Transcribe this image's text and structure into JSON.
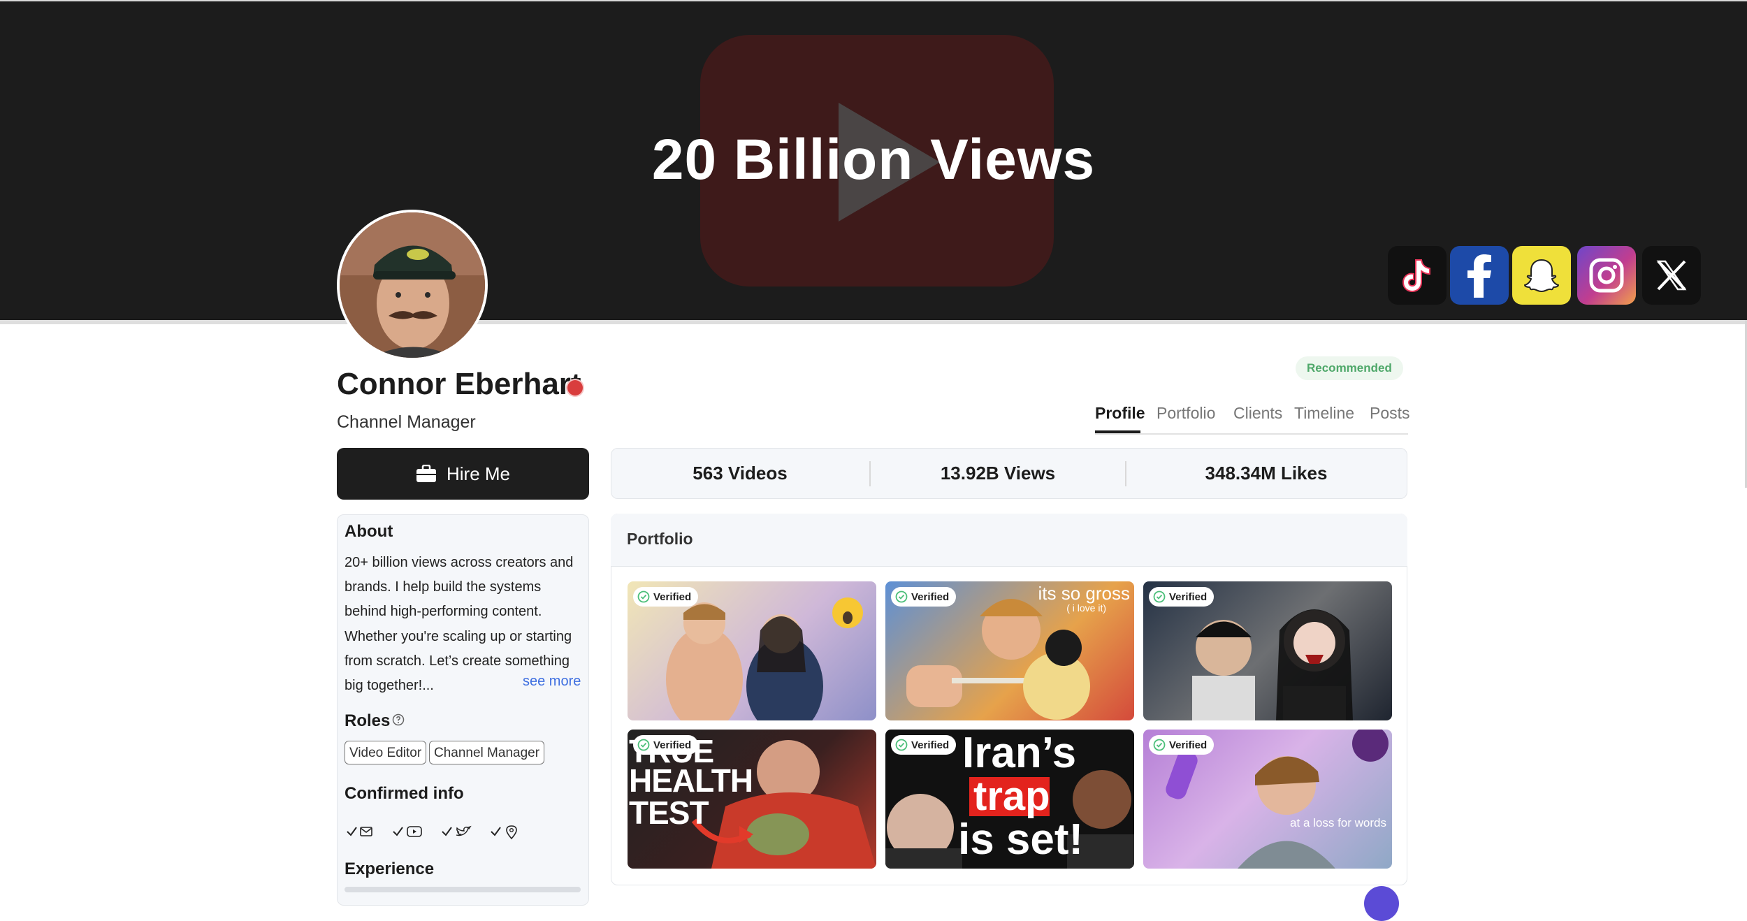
{
  "banner": {
    "title": "20 Billion Views"
  },
  "social": [
    "tiktok-icon",
    "facebook-icon",
    "snapchat-icon",
    "instagram-icon",
    "x-icon"
  ],
  "profile": {
    "name": "Connor Eberhart",
    "title": "Channel Manager",
    "badge": "Recommended",
    "hire_label": "Hire Me"
  },
  "tabs": [
    "Profile",
    "Portfolio",
    "Clients",
    "Timeline",
    "Posts"
  ],
  "stats": [
    {
      "label": "563 Videos"
    },
    {
      "label": "13.92B Views"
    },
    {
      "label": "348.34M Likes"
    }
  ],
  "about": {
    "heading": "About",
    "text": "20+ billion views across creators and brands. I help build the systems behind high-performing content. Whether you're scaling up or starting from scratch. Let’s create something big together!...",
    "see_more": "see more"
  },
  "roles": {
    "heading": "Roles",
    "items": [
      "Video Editor",
      "Channel Manager"
    ]
  },
  "confirmed": {
    "heading": "Confirmed info",
    "items": [
      "email-icon",
      "youtube-icon",
      "twitter-icon",
      "location-icon"
    ]
  },
  "experience": {
    "heading": "Experience"
  },
  "portfolio": {
    "heading": "Portfolio",
    "verified_label": "Verified",
    "thumb_texts": {
      "t2_top": "its so gross",
      "t2_sub": "( i love it)",
      "t4_line1": "TRUE",
      "t4_line2": "HEALTH",
      "t4_line3": "TEST",
      "t5_line1": "Iran’s",
      "t5_line2": "trap",
      "t5_line3": "is set!",
      "t6_caption": "at a loss for words"
    }
  },
  "colors": {
    "banner": "#1c1c1c",
    "accent_link": "#3d6ee0",
    "recommended_text": "#4fa86a",
    "verified_green": "#4cbf7a"
  }
}
